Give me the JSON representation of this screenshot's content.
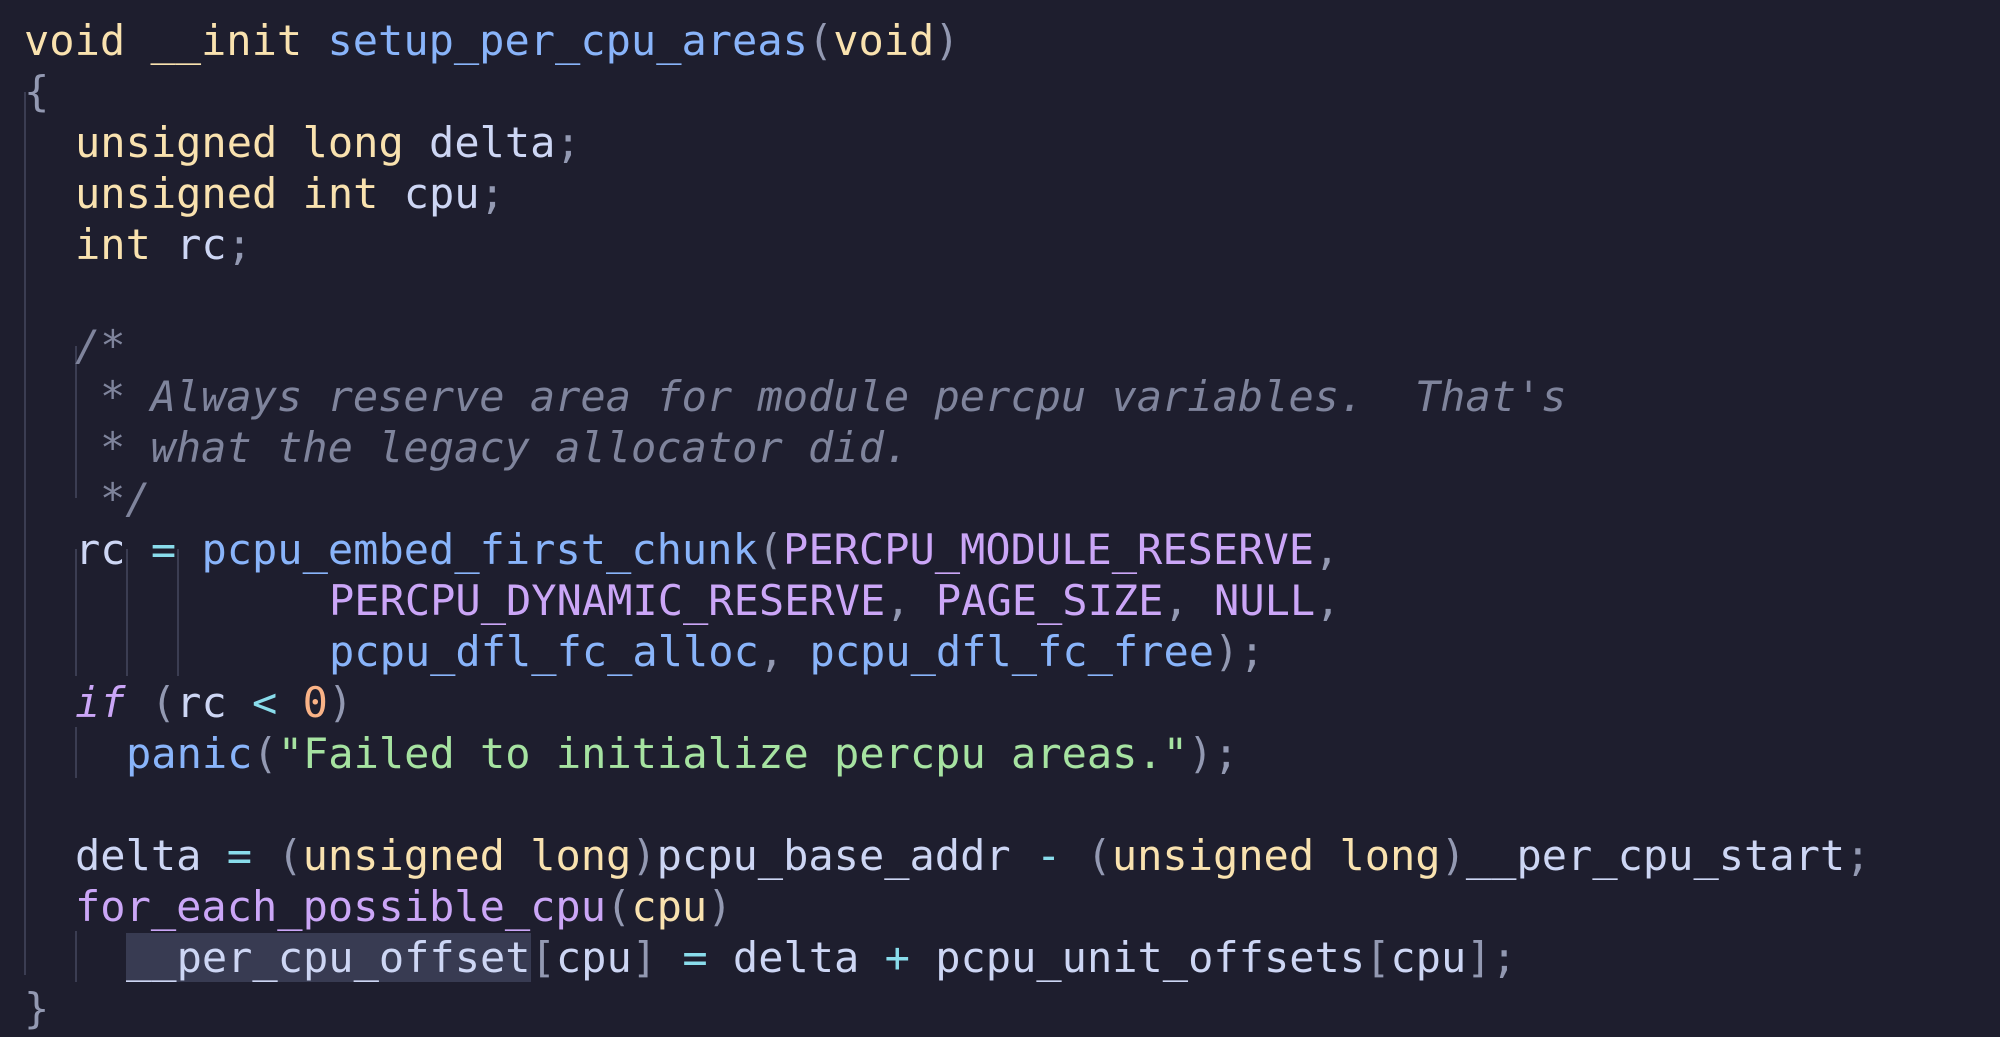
{
  "window": {
    "language": "c",
    "highlighted_token": "__per_cpu_offset"
  },
  "code": {
    "l01": {
      "t1": "void",
      "t2": " ",
      "t3": "__init",
      "t4": " ",
      "t5": "setup_per_cpu_areas",
      "t6": "(",
      "t7": "void",
      "t8": ")"
    },
    "l02": {
      "t1": "{"
    },
    "l03": {
      "t1": "unsigned",
      "t2": " ",
      "t3": "long",
      "t4": " delta",
      "t5": ";"
    },
    "l04": {
      "t1": "unsigned",
      "t2": " ",
      "t3": "int",
      "t4": " cpu",
      "t5": ";"
    },
    "l05": {
      "t1": "int",
      "t2": " rc",
      "t3": ";"
    },
    "l07": {
      "t1": "/*"
    },
    "l08": {
      "t1": "* Always reserve area for module percpu variables.  That's"
    },
    "l09": {
      "t1": "* what the legacy allocator did."
    },
    "l10": {
      "t1": "*/"
    },
    "l11": {
      "t1": "rc ",
      "t2": "=",
      "t3": " ",
      "t4": "pcpu_embed_first_chunk",
      "t5": "(",
      "t6": "PERCPU_MODULE_RESERVE",
      "t7": ","
    },
    "l12": {
      "t1": "PERCPU_DYNAMIC_RESERVE",
      "t2": ", ",
      "t3": "PAGE_SIZE",
      "t4": ", ",
      "t5": "NULL",
      "t6": ","
    },
    "l13": {
      "t1": "pcpu_dfl_fc_alloc",
      "t2": ", ",
      "t3": "pcpu_dfl_fc_free",
      "t4": ");"
    },
    "l14": {
      "t1": "if",
      "t2": " ",
      "t3": "(",
      "t4": "rc ",
      "t5": "<",
      "t6": " ",
      "t7": "0",
      "t8": ")"
    },
    "l15": {
      "t1": "panic",
      "t2": "(",
      "t3": "\"Failed to initialize percpu areas.\"",
      "t4": ");"
    },
    "l17": {
      "t1": "delta ",
      "t2": "=",
      "t3": " ",
      "t4": "(",
      "t5": "unsigned",
      "t6": " ",
      "t7": "long",
      "t8": ")",
      "t9": "pcpu_base_addr ",
      "t10": "-",
      "t11": " ",
      "t12": "(",
      "t13": "unsigned",
      "t14": " ",
      "t15": "long",
      "t16": ")",
      "t17": "__per_cpu_start",
      "t18": ";"
    },
    "l18": {
      "t1": "for_each_possible_cpu",
      "t2": "(",
      "t3": "cpu",
      "t4": ")"
    },
    "l19": {
      "t1": "__per_cpu_offset",
      "t2": "[",
      "t3": "cpu",
      "t4": "]",
      "t5": " ",
      "t6": "=",
      "t7": " delta ",
      "t8": "+",
      "t9": " pcpu_unit_offsets",
      "t10": "[",
      "t11": "cpu",
      "t12": "];"
    },
    "l20": {
      "t1": "}"
    }
  },
  "colors": {
    "background": "#1e1e2e",
    "keyword": "#f9e2af",
    "function": "#89b4fa",
    "macro": "#cba6f7",
    "string": "#a6e3a1",
    "number": "#fab387",
    "comment": "#7f849c",
    "operator": "#89dceb"
  }
}
